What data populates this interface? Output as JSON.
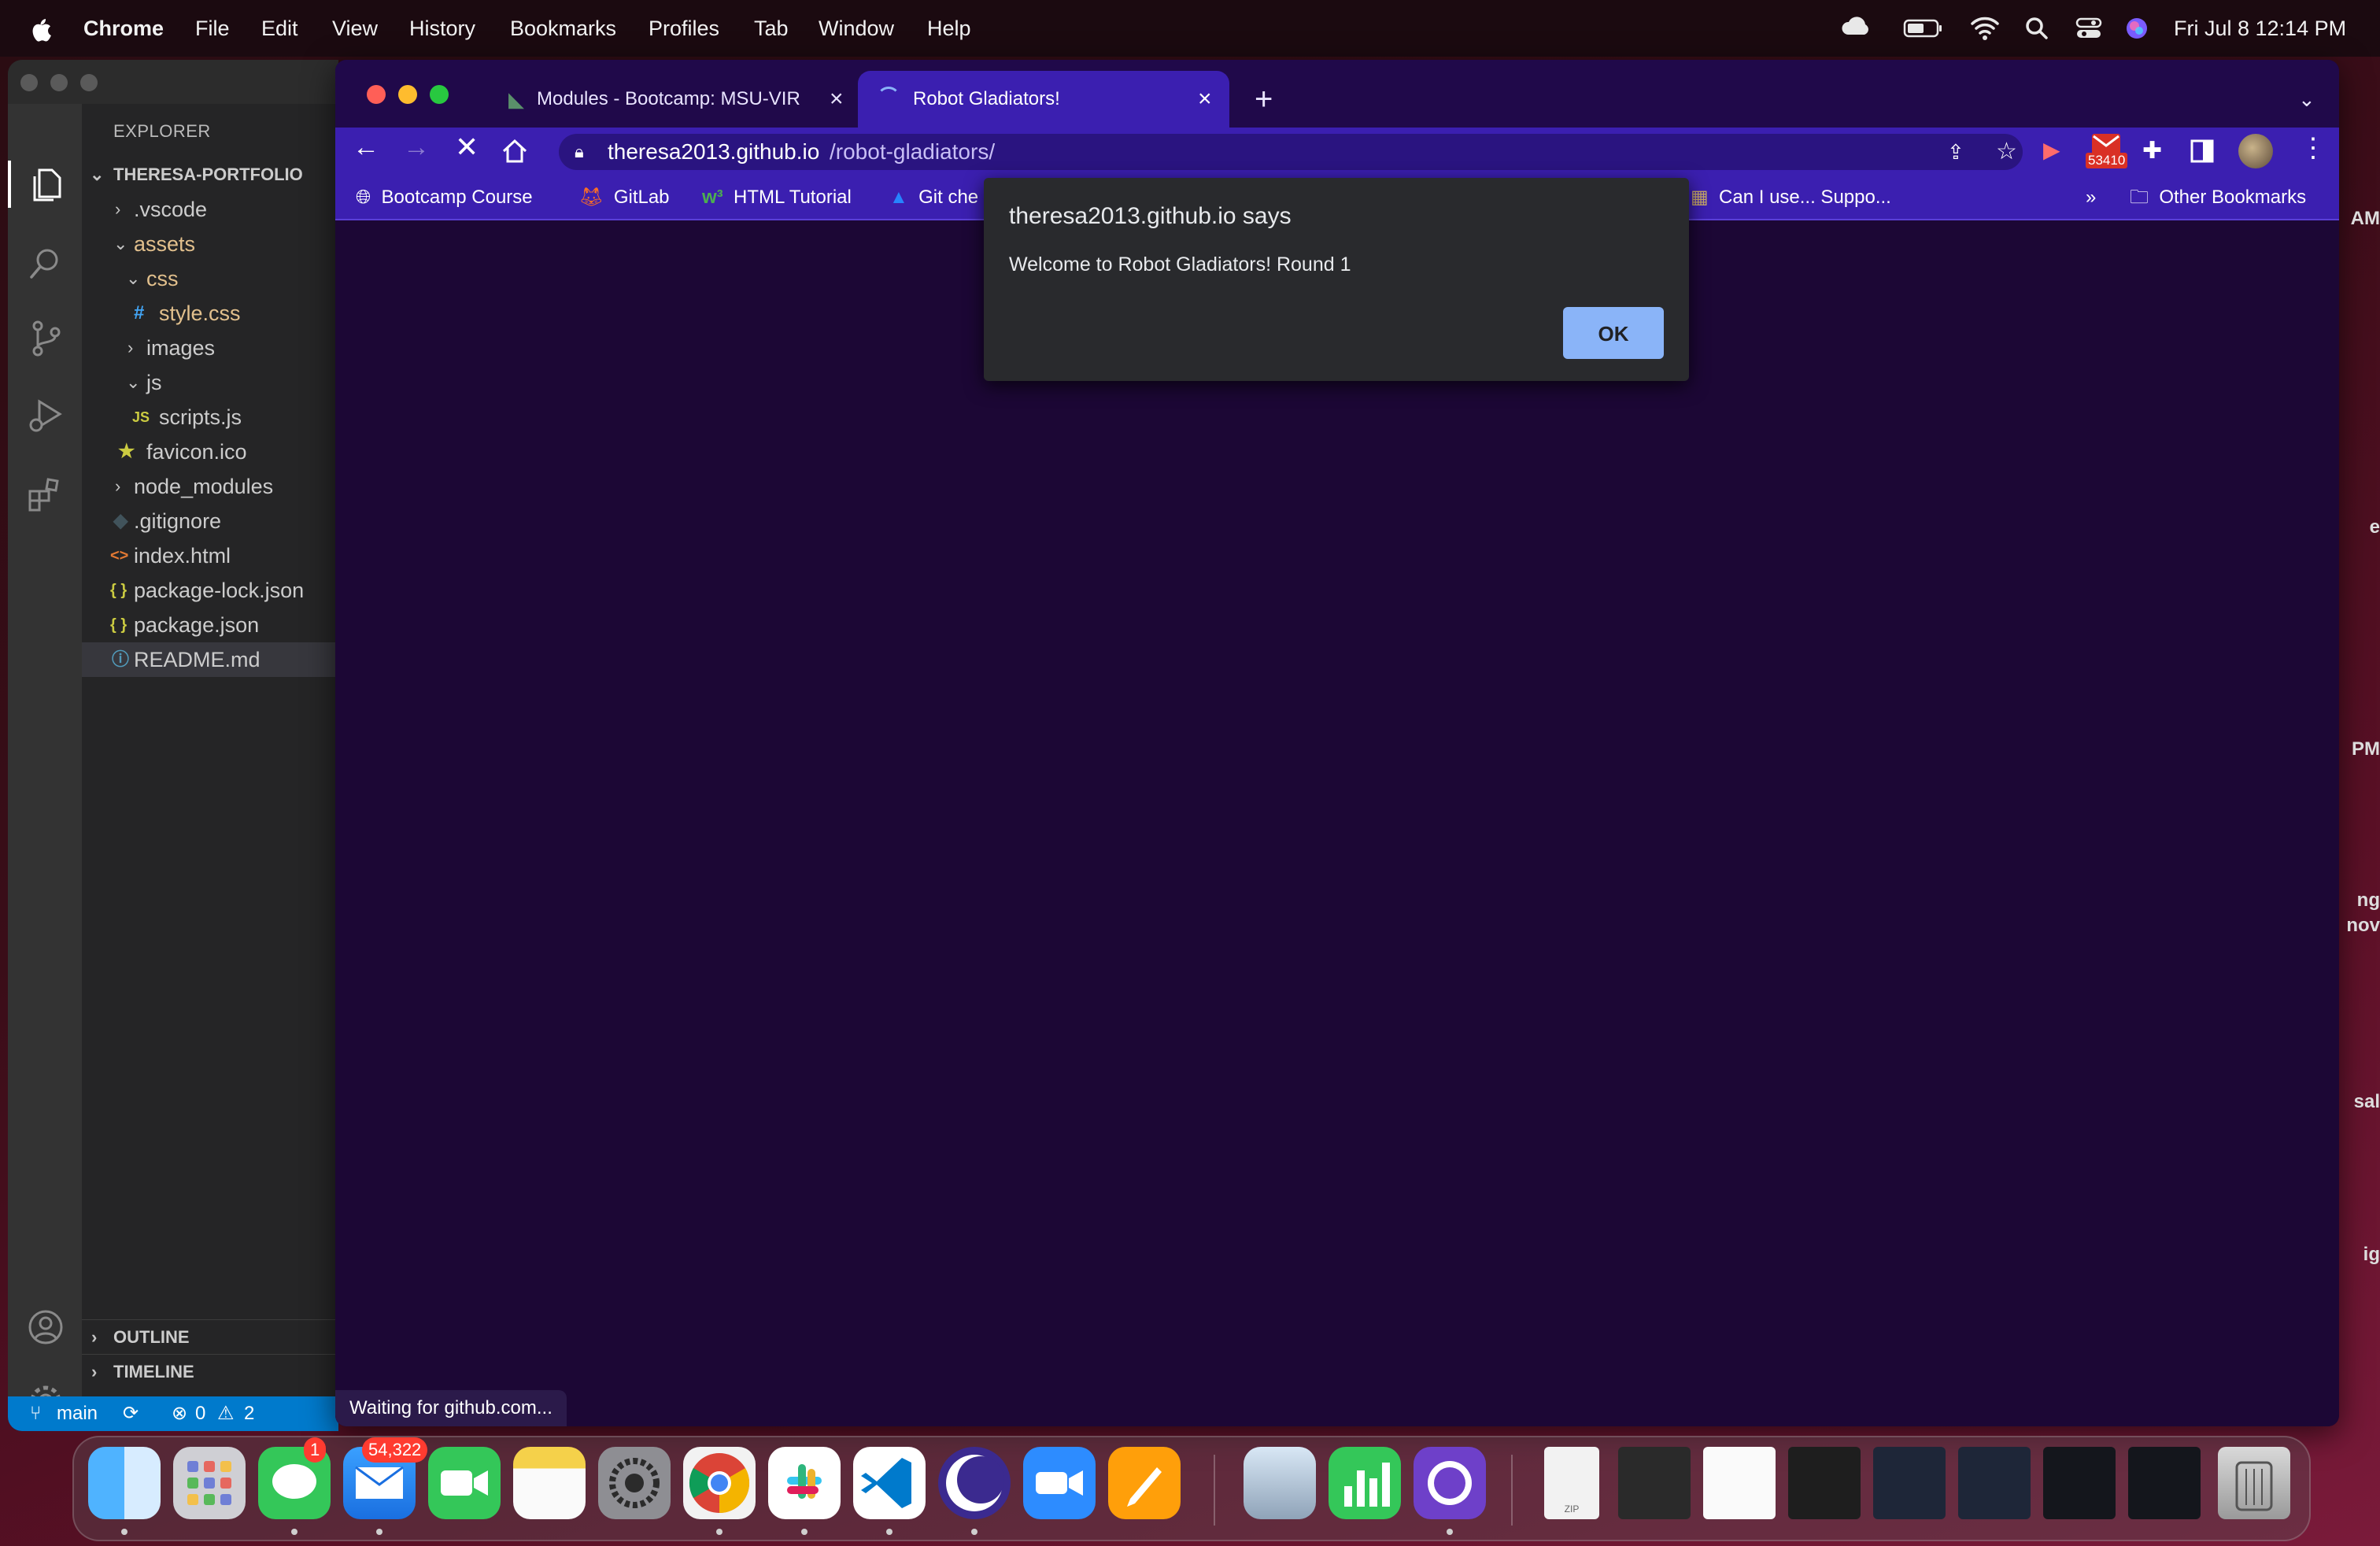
{
  "menubar": {
    "app": "Chrome",
    "items": [
      "File",
      "Edit",
      "View",
      "History",
      "Bookmarks",
      "Profiles",
      "Tab",
      "Window",
      "Help"
    ],
    "datetime": "Fri Jul 8  12:14 PM"
  },
  "vscode": {
    "explorer_title": "EXPLORER",
    "project": "THERESA-PORTFOLIO",
    "tree": [
      {
        "label": ".vscode",
        "kind": "folder-closed"
      },
      {
        "label": "assets",
        "kind": "folder-open"
      },
      {
        "label": "css",
        "kind": "folder-open"
      },
      {
        "label": "style.css",
        "kind": "css-file"
      },
      {
        "label": "images",
        "kind": "folder-closed"
      },
      {
        "label": "js",
        "kind": "folder-open"
      },
      {
        "label": "scripts.js",
        "kind": "js-file"
      },
      {
        "label": "favicon.ico",
        "kind": "ico-file"
      },
      {
        "label": "node_modules",
        "kind": "folder-closed"
      },
      {
        "label": ".gitignore",
        "kind": "git-file"
      },
      {
        "label": "index.html",
        "kind": "html-file"
      },
      {
        "label": "package-lock.json",
        "kind": "json-file"
      },
      {
        "label": "package.json",
        "kind": "json-file"
      },
      {
        "label": "README.md",
        "kind": "info-file"
      }
    ],
    "outline": "OUTLINE",
    "timeline": "TIMELINE",
    "status": {
      "branch": "main",
      "errors": "0",
      "warnings": "2"
    }
  },
  "chrome": {
    "tabs": [
      {
        "title": "Modules - Bootcamp: MSU-VIR",
        "active": false
      },
      {
        "title": "Robot Gladiators!",
        "active": true
      }
    ],
    "url_host": "theresa2013.github.io",
    "url_path": "/robot-gladiators/",
    "gmail_badge": "53410",
    "bookmarks": [
      "Bootcamp Course",
      "GitLab",
      "HTML Tutorial",
      "Git che",
      "Can I use... Suppo..."
    ],
    "overflow": "»",
    "other_bookmarks": "Other Bookmarks",
    "status": "Waiting for github.com..."
  },
  "dialog": {
    "title": "theresa2013.github.io says",
    "message": "Welcome to Robot Gladiators! Round 1",
    "ok": "OK"
  },
  "right_edge": [
    "AM",
    "e",
    "PM",
    "ng",
    "nov",
    "sal",
    "ig"
  ],
  "dock": {
    "messages_badge": "1",
    "mail_badge": "54,322",
    "zip_label": "ZIP"
  }
}
